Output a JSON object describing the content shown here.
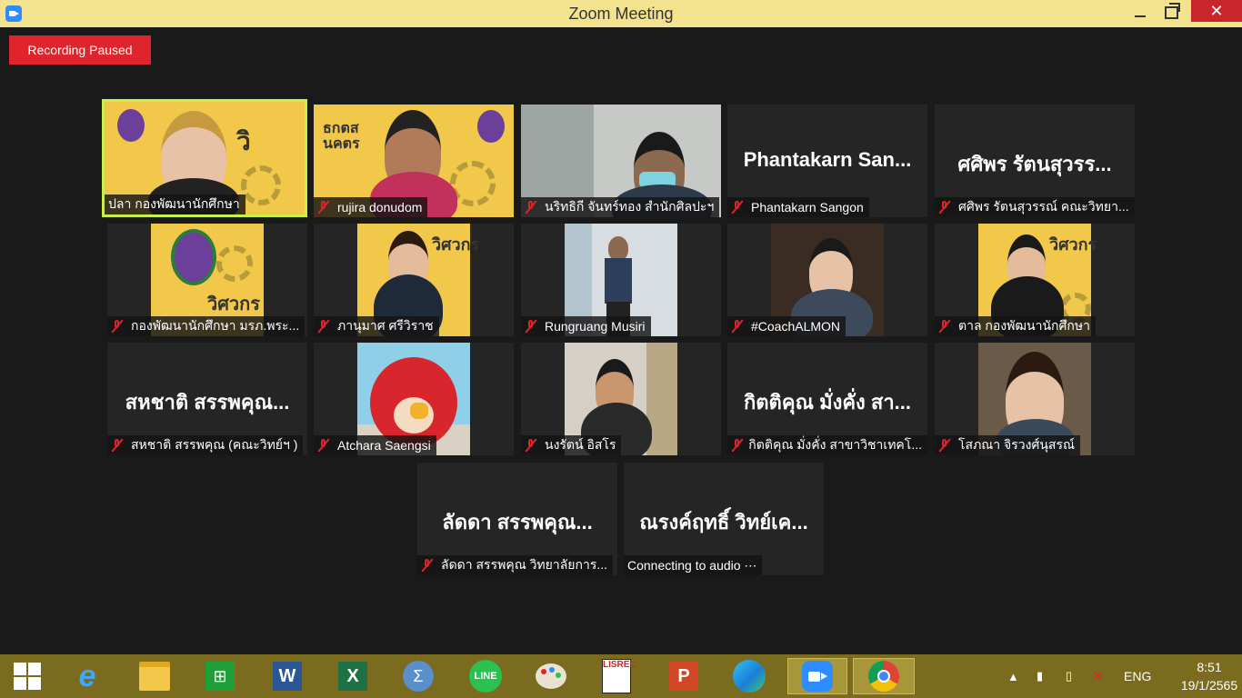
{
  "window": {
    "title": "Zoom Meeting"
  },
  "recording": {
    "label": "Recording Paused"
  },
  "participants": [
    {
      "big": "",
      "label": "ปลา กองพัฒนานักศึกษา",
      "muted": false
    },
    {
      "big": "",
      "label": "rujira donudom",
      "muted": true
    },
    {
      "big": "",
      "label": "นริทธิกี จันทร์ทอง สำนักศิลปะฯ",
      "muted": true
    },
    {
      "big": "Phantakarn San...",
      "label": "Phantakarn Sangon",
      "muted": true
    },
    {
      "big": "ศศิพร รัตนสุวรร...",
      "label": "ศศิพร รัตนสุวรรณ์ คณะวิทยา...",
      "muted": true
    },
    {
      "big": "",
      "label": "กองพัฒนานักศึกษา มรภ.พระ...",
      "muted": true
    },
    {
      "big": "",
      "label": "ภานุมาศ ศรีวิราช",
      "muted": true
    },
    {
      "big": "",
      "label": "Rungruang Musiri",
      "muted": true
    },
    {
      "big": "",
      "label": "#CoachALMON",
      "muted": true
    },
    {
      "big": "",
      "label": "ตาล กองพัฒนานักศึกษา",
      "muted": true
    },
    {
      "big": "สหชาติ สรรพคุณ...",
      "label": "สหชาติ สรรพคุณ (คณะวิทย์ฯ )",
      "muted": true
    },
    {
      "big": "",
      "label": "Atchara Saengsi",
      "muted": true
    },
    {
      "big": "",
      "label": "นงรัตน์ อิสโร",
      "muted": true
    },
    {
      "big": "กิตติคุณ  มั่งคั่ง สา...",
      "label": "กิตติคุณ  มั่งคั่ง สาขาวิชาเทคโ...",
      "muted": true
    },
    {
      "big": "",
      "label": "โสภณา จิรวงศ์นุสรณ์",
      "muted": true
    },
    {
      "big": "ลัดดา สรรพคุณ...",
      "label": "ลัดดา สรรพคุณ  วิทยาลัยการ...",
      "muted": true
    },
    {
      "big": "ณรงค์ฤทธิ์ วิทย์เค...",
      "label": "Connecting to audio ⋯",
      "muted": false
    }
  ],
  "taskbar": {
    "icons": [
      "windows-start-icon",
      "internet-explorer-icon",
      "file-explorer-icon",
      "store-icon",
      "word-icon",
      "excel-icon",
      "math-input-icon",
      "line-icon",
      "paint-icon",
      "lisrel-icon",
      "powerpoint-icon",
      "edge-icon",
      "zoom-icon",
      "chrome-icon"
    ],
    "language": "ENG",
    "time": "8:51",
    "date": "19/1/2565"
  },
  "colors": {
    "title_bar": "#f3e38f",
    "recording": "#e0242b",
    "active_speaker": "#c9ef4a",
    "taskbar": "#7a6b1e"
  }
}
